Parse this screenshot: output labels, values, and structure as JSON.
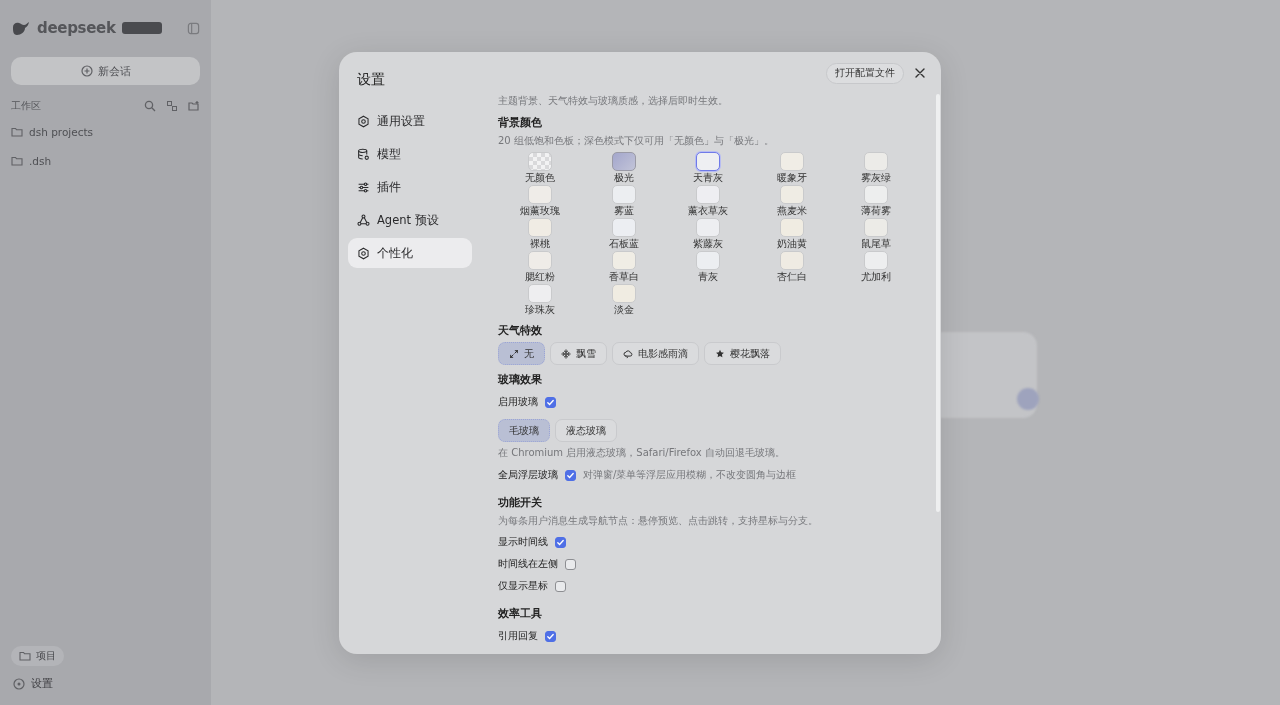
{
  "sidebar": {
    "brand": "deepseek",
    "new_chat": "新会话",
    "workspace_label": "工作区",
    "folders": [
      {
        "name": "dsh projects"
      },
      {
        "name": ".dsh"
      }
    ],
    "projects_button": "项目",
    "settings_button": "设置"
  },
  "dialog": {
    "title": "设置",
    "open_config_button": "打开配置文件",
    "nav": [
      {
        "label": "通用设置",
        "selected": false
      },
      {
        "label": "模型",
        "selected": false
      },
      {
        "label": "插件",
        "selected": false
      },
      {
        "label": "Agent 预设",
        "selected": false
      },
      {
        "label": "个性化",
        "selected": true
      }
    ],
    "intro": "主题背景、天气特效与玻璃质感，选择后即时生效。",
    "background": {
      "heading": "背景颜色",
      "hint": "20 组低饱和色板；深色模式下仅可用「无颜色」与「极光」。",
      "swatches": [
        {
          "name": "无颜色",
          "kind": "none",
          "selected": false
        },
        {
          "name": "极光",
          "kind": "aurora",
          "color": "#a3a6cc",
          "selected": false
        },
        {
          "name": "天青灰",
          "kind": "plain",
          "color": "#eeeff2",
          "selected": true
        },
        {
          "name": "暖象牙",
          "kind": "plain",
          "color": "#f0ede6",
          "selected": false
        },
        {
          "name": "雾灰绿",
          "kind": "plain",
          "color": "#ecebe8",
          "selected": false
        },
        {
          "name": "烟薰玫瑰",
          "kind": "plain",
          "color": "#efece8",
          "selected": false
        },
        {
          "name": "雾蓝",
          "kind": "plain",
          "color": "#eceef1",
          "selected": false
        },
        {
          "name": "薰衣草灰",
          "kind": "plain",
          "color": "#eeeef2",
          "selected": false
        },
        {
          "name": "燕麦米",
          "kind": "plain",
          "color": "#efece4",
          "selected": false
        },
        {
          "name": "薄荷雾",
          "kind": "plain",
          "color": "#edeeee",
          "selected": false
        },
        {
          "name": "裸桃",
          "kind": "plain",
          "color": "#f0ece4",
          "selected": false
        },
        {
          "name": "石板蓝",
          "kind": "plain",
          "color": "#eceef2",
          "selected": false
        },
        {
          "name": "紫藤灰",
          "kind": "plain",
          "color": "#edeef1",
          "selected": false
        },
        {
          "name": "奶油黄",
          "kind": "plain",
          "color": "#f0ece2",
          "selected": false
        },
        {
          "name": "鼠尾草",
          "kind": "plain",
          "color": "#ecebe7",
          "selected": false
        },
        {
          "name": "腮红粉",
          "kind": "plain",
          "color": "#efece8",
          "selected": false
        },
        {
          "name": "香草白",
          "kind": "plain",
          "color": "#f0ede5",
          "selected": false
        },
        {
          "name": "青灰",
          "kind": "plain",
          "color": "#eceef1",
          "selected": false
        },
        {
          "name": "杏仁白",
          "kind": "plain",
          "color": "#efebe3",
          "selected": false
        },
        {
          "name": "尤加利",
          "kind": "plain",
          "color": "#edeeef",
          "selected": false
        },
        {
          "name": "珍珠灰",
          "kind": "plain",
          "color": "#eeeef0",
          "selected": false
        },
        {
          "name": "淡金",
          "kind": "plain",
          "color": "#f0ece2",
          "selected": false
        }
      ]
    },
    "weather": {
      "heading": "天气特效",
      "options": [
        {
          "label": "无",
          "selected": true
        },
        {
          "label": "飘雪",
          "selected": false
        },
        {
          "label": "电影感雨滴",
          "selected": false
        },
        {
          "label": "樱花飘落",
          "selected": false
        }
      ]
    },
    "glass": {
      "heading": "玻璃效果",
      "enable_label": "启用玻璃",
      "enabled": true,
      "modes": [
        {
          "label": "毛玻璃",
          "selected": true
        },
        {
          "label": "液态玻璃",
          "selected": false
        }
      ],
      "note": "在 Chromium 启用液态玻璃，Safari/Firefox 自动回退毛玻璃。",
      "overlay_label": "全局浮层玻璃",
      "overlay_checked": true,
      "overlay_hint": "对弹窗/菜单等浮层应用模糊，不改变圆角与边框"
    },
    "features": {
      "heading": "功能开关",
      "hint": "为每条用户消息生成导航节点：悬停预览、点击跳转，支持星标与分支。",
      "toggles": [
        {
          "label": "显示时间线",
          "checked": true
        },
        {
          "label": "时间线在左侧",
          "checked": false
        },
        {
          "label": "仅显示星标",
          "checked": false
        }
      ]
    },
    "tools": {
      "heading": "效率工具",
      "toggles": [
        {
          "label": "引用回复",
          "checked": true
        }
      ]
    }
  }
}
